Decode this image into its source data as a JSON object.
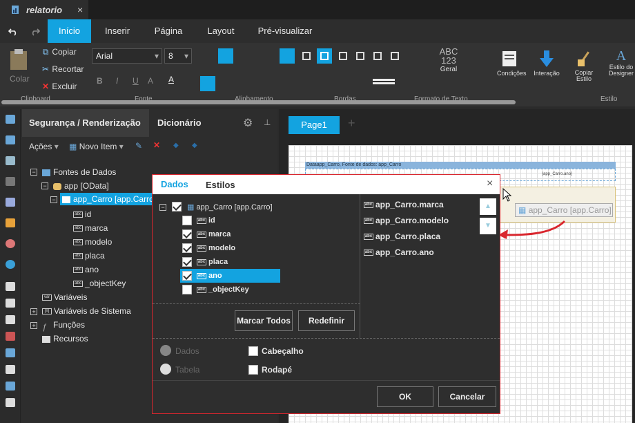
{
  "doc_tab": {
    "title": "relatorio",
    "close": "×"
  },
  "ribbon_tabs": [
    "Início",
    "Inserir",
    "Página",
    "Layout",
    "Pré-visualizar"
  ],
  "clipboard": {
    "paste": "Colar",
    "copy": "Copiar",
    "cut": "Recortar",
    "delete": "Excluir",
    "group": "Clipboard"
  },
  "font": {
    "family": "Arial",
    "size": "8",
    "group": "Fonte"
  },
  "groups": {
    "align": "Alinhamento",
    "borders": "Bordas",
    "textformat": "Formato de Texto",
    "style": "Estilo"
  },
  "format_block": {
    "abc": "ABC",
    "num": "123",
    "label": "Geral"
  },
  "big_buttons": {
    "conditions": "Condições",
    "interaction": "Interação",
    "copy_style": "Copiar Estilo",
    "designer_style": "Estilo do Designer"
  },
  "panel": {
    "tab1": "Segurança / Renderização",
    "tab2": "Dicionário",
    "actions": "Ações",
    "new_item": "Novo Item"
  },
  "tree": {
    "datasources": "Fontes de Dados",
    "app": "app [OData]",
    "table": "app_Carro [app.Carro]",
    "fields": [
      "id",
      "marca",
      "modelo",
      "placa",
      "ano",
      "_objectKey"
    ],
    "variables": "Variáveis",
    "sysvars": "Variáveis de Sistema",
    "functions": "Funções",
    "resources": "Recursos"
  },
  "page_tab": "Page1",
  "design": {
    "header_text": "Dataapp_Carro, Fonte de dados: app_Carro",
    "field_text": "{app_Carro.ano}",
    "drag_label": "app_Carro [app.Carro]"
  },
  "dialog": {
    "tab1": "Dados",
    "tab2": "Estilos",
    "close": "×",
    "table": "app_Carro [app.Carro]",
    "fields": [
      "id",
      "marca",
      "modelo",
      "placa",
      "ano",
      "_objectKey"
    ],
    "checked": [
      false,
      true,
      true,
      true,
      true,
      false
    ],
    "selected": [
      "app_Carro.marca",
      "app_Carro.modelo",
      "app_Carro.placa",
      "app_Carro.ano"
    ],
    "mark_all": "Marcar Todos",
    "reset": "Redefinir",
    "radio_data": "Dados",
    "radio_table": "Tabela",
    "header_cb": "Cabeçalho",
    "footer_cb": "Rodapé",
    "ok": "OK",
    "cancel": "Cancelar"
  },
  "colors": {
    "accent": "#13a3e0",
    "dialog_border": "#d9262e"
  }
}
